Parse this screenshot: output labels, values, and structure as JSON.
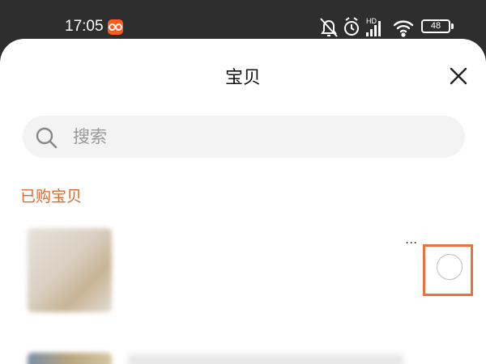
{
  "status_bar": {
    "time": "17:05",
    "network_label": "HD",
    "battery": "48",
    "icons": [
      "app-icon",
      "mute-bell-icon",
      "alarm-icon",
      "signal-icon",
      "wifi-icon",
      "battery-icon"
    ]
  },
  "sheet": {
    "title": "宝贝",
    "close_icon": "close-icon"
  },
  "search": {
    "placeholder": "搜索",
    "value": ""
  },
  "section": {
    "heading": "已购宝贝"
  },
  "items": [
    {
      "title": "",
      "title_visible_suffix": "...",
      "selected": false
    },
    {
      "title": "",
      "selected": false
    }
  ],
  "colors": {
    "accent": "#e0672a",
    "highlight_border": "#ef6f3c",
    "status_bar_bg": "#2e2e2e",
    "search_bg": "#f3f3f3"
  }
}
